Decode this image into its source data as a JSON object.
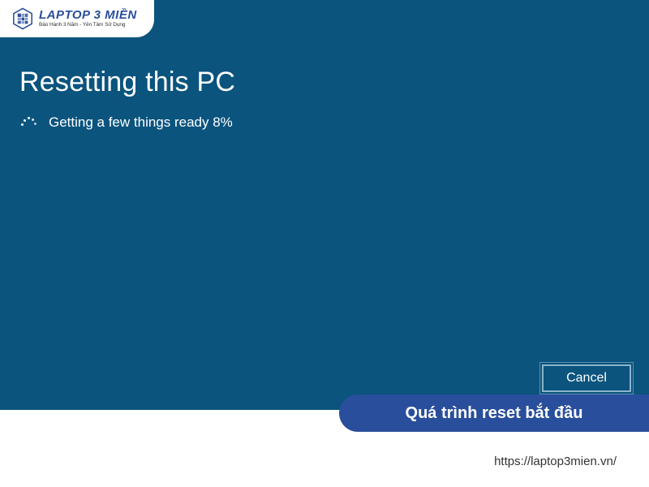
{
  "logo": {
    "title": "LAPTOP 3 MIỀN",
    "tagline": "Bảo Hành 3 Năm - Yên Tâm Sử Dụng"
  },
  "heading": "Resetting this PC",
  "status": {
    "text": "Getting a few things ready 8%",
    "percent": 8
  },
  "cancel_label": "Cancel",
  "caption": "Quá trình reset bắt đầu",
  "footer_url": "https://laptop3mien.vn/",
  "colors": {
    "screen_bg": "#0a547e",
    "brand_blue": "#294e9b"
  }
}
